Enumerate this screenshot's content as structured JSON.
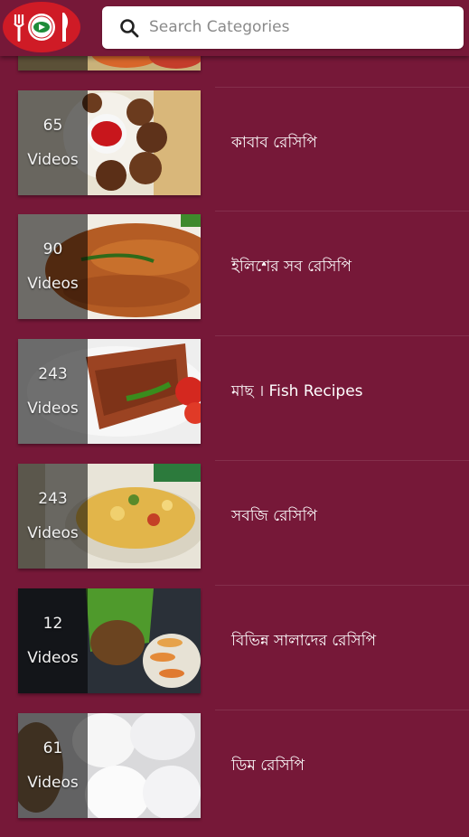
{
  "header": {
    "logo_icon": "plate-fork-knife-play-icon",
    "search": {
      "placeholder": "Search Categories",
      "value": "",
      "icon": "search-icon"
    }
  },
  "categories": [
    {
      "count": "65",
      "count_unit": "Videos",
      "title": "কাবাব রেসিপি"
    },
    {
      "count": "90",
      "count_unit": "Videos",
      "title": "ইলিশের সব রেসিপি"
    },
    {
      "count": "243",
      "count_unit": "Videos",
      "title": "মাছ । Fish Recipes"
    },
    {
      "count": "243",
      "count_unit": "Videos",
      "title": "সবজি রেসিপি"
    },
    {
      "count": "12",
      "count_unit": "Videos",
      "title": "বিভিন্ন সালাদের রেসিপি"
    },
    {
      "count": "61",
      "count_unit": "Videos",
      "title": "ডিম রেসিপি"
    }
  ],
  "colors": {
    "background": "#761838",
    "logo_red": "#cf1b26",
    "text": "#ffffff"
  }
}
